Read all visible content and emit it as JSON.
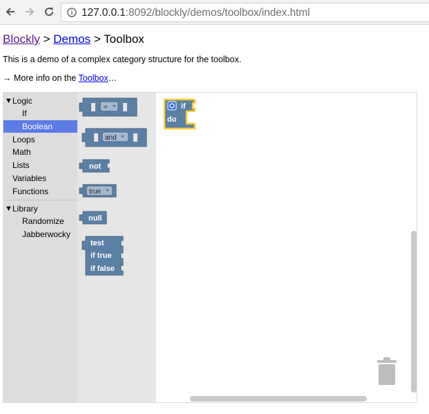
{
  "browser": {
    "url_host": "127.0.0.1",
    "url_rest": ":8092/blockly/demos/toolbox/index.html"
  },
  "page": {
    "breadcrumb": {
      "blockly": "Blockly",
      "sep1": " > ",
      "demos": "Demos",
      "sep2": " > ",
      "current": "Toolbox"
    },
    "description": "This is a demo of a complex category structure for the toolbox.",
    "more_prefix": "→ More info on the ",
    "more_link": "Toolbox",
    "more_suffix": "…"
  },
  "toolbox": {
    "categories": [
      {
        "label": "Logic",
        "expanded": true
      },
      {
        "label": "If"
      },
      {
        "label": "Boolean",
        "selected": true
      },
      {
        "label": "Loops"
      },
      {
        "label": "Math"
      },
      {
        "label": "Lists"
      },
      {
        "label": "Variables"
      },
      {
        "label": "Functions"
      },
      {
        "label": "Library",
        "expanded": true
      },
      {
        "label": "Randomize"
      },
      {
        "label": "Jabberwocky"
      }
    ]
  },
  "flyout": {
    "compare_op": "=",
    "operation_op": "and",
    "negate": "not",
    "boolean_value": "true",
    "null": "null",
    "ternary": {
      "test": "test",
      "if_true": "if true",
      "if_false": "if false"
    }
  },
  "workspace": {
    "if_block": {
      "if": "if",
      "do": "do"
    }
  },
  "colors": {
    "logic_block": "#5b80a5",
    "logic_block_dark": "#496684",
    "selected_category": "#5b7be6",
    "selection_outline": "#fc3",
    "link_visited": "#551a8b",
    "link": "#0000ee"
  },
  "icons": [
    "back-arrow-icon",
    "forward-arrow-icon",
    "reload-icon",
    "info-icon",
    "gear-icon",
    "trash-icon"
  ]
}
